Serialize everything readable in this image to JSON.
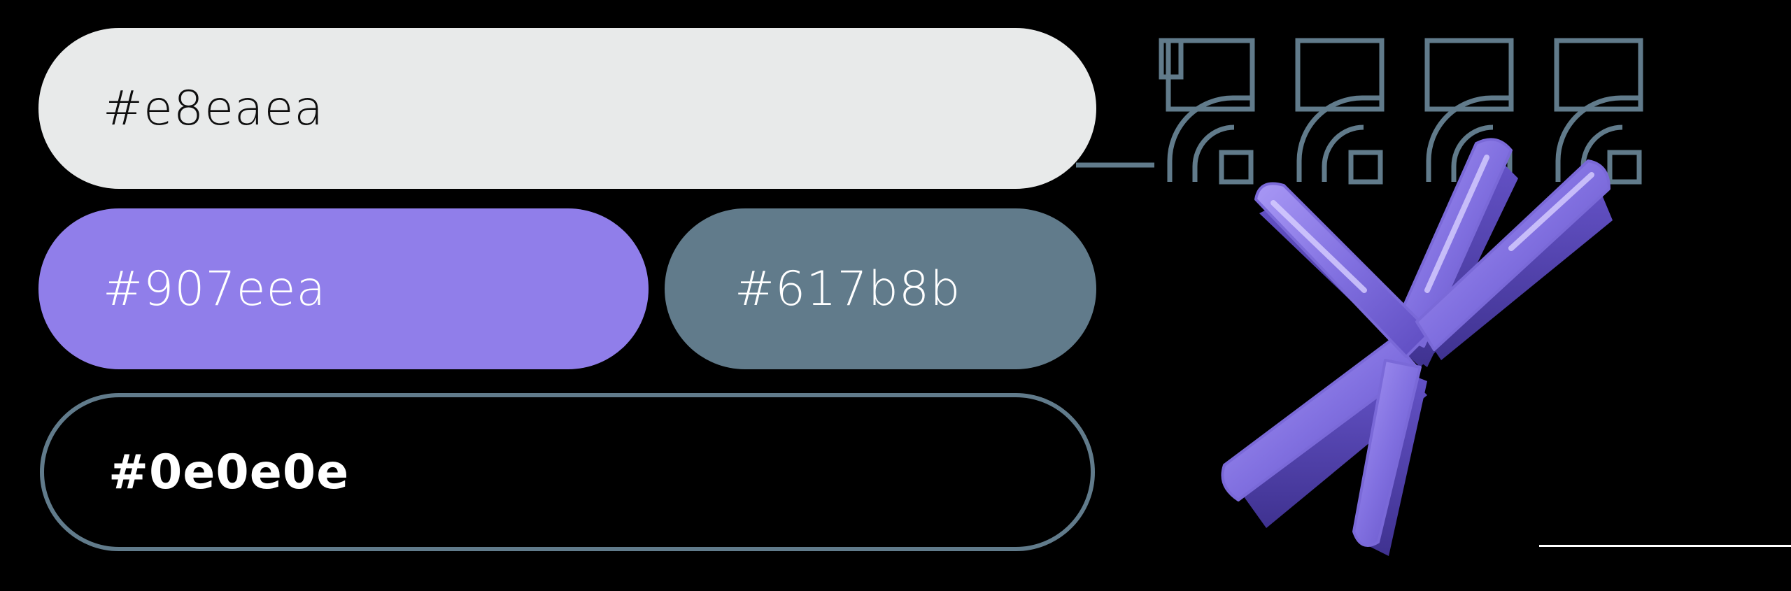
{
  "swatches": {
    "light": {
      "label": "#e8eaea",
      "color": "#e8eaea"
    },
    "purple": {
      "label": "#907eea",
      "color": "#907eea"
    },
    "slate": {
      "label": "#617b8b",
      "color": "#617b8b"
    },
    "dark": {
      "label": "#0e0e0e",
      "color": "#0e0e0e"
    }
  },
  "decorations": {
    "pattern_icon": "wifi-arc-grid-icon",
    "asterisk_icon": "asterisk-3d-icon",
    "accent_color": "#907eea",
    "outline_color": "#617b8b"
  }
}
